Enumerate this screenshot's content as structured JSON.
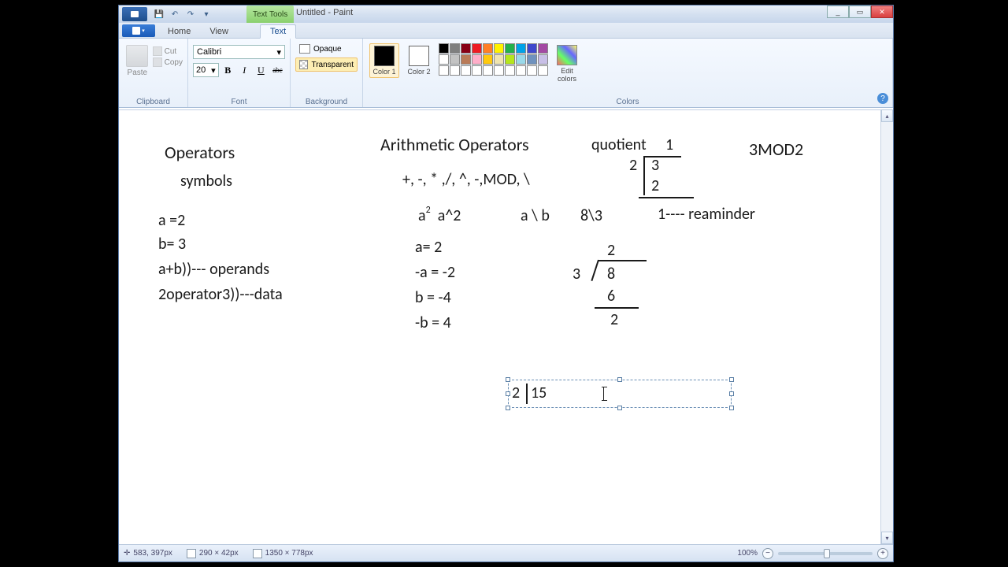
{
  "titlebar": {
    "text_tools": "Text Tools",
    "title": "Untitled - Paint",
    "min": "_",
    "max": "▭",
    "close": "✕"
  },
  "tabs": {
    "home": "Home",
    "view": "View",
    "text": "Text"
  },
  "ribbon": {
    "clipboard": {
      "paste": "Paste",
      "cut": "Cut",
      "copy": "Copy",
      "label": "Clipboard"
    },
    "font": {
      "name": "Calibri",
      "size": "20",
      "b": "B",
      "i": "I",
      "u": "U",
      "s": "abc",
      "label": "Font"
    },
    "background": {
      "opaque": "Opaque",
      "transparent": "Transparent",
      "label": "Background"
    },
    "colors": {
      "color1": "Color 1",
      "color2": "Color 2",
      "edit": "Edit colors",
      "label": "Colors"
    }
  },
  "palette": {
    "row1": [
      "#000000",
      "#7f7f7f",
      "#880015",
      "#ed1c24",
      "#ff7f27",
      "#fff200",
      "#22b14c",
      "#00a2e8",
      "#3f48cc",
      "#a349a4"
    ],
    "row2": [
      "#ffffff",
      "#c3c3c3",
      "#b97a57",
      "#ffaec9",
      "#ffc90e",
      "#efe4b0",
      "#b5e61d",
      "#99d9ea",
      "#7092be",
      "#c8bfe7"
    ]
  },
  "canvas": {
    "c1": "Operators",
    "c2": "symbols",
    "c3": "a =2",
    "c4": "b= 3",
    "c5": "a+b))--- operands",
    "c6": "2operator3))---data",
    "c7": "Arithmetic Operators",
    "c8": "+, -, * ,/, ^, -,MOD, \\",
    "c9a": "a",
    "c9b": "2",
    "c9c": "a^2",
    "c10": "a \\ b",
    "c11": "8\\3",
    "c12": "a= 2",
    "c13": "-a =  -2",
    "c14": "b = -4",
    "c15": "-b = 4",
    "c16": "quotient",
    "c17": "1",
    "c18": "2",
    "c19": "3",
    "c20": "2",
    "c21": "1---- reaminder",
    "c22": "3MOD2",
    "c23": "2",
    "c24": "3",
    "c25": "8",
    "c26": "6",
    "c27": "2",
    "tb1": "2",
    "tb2": "15"
  },
  "status": {
    "pos": "583, 397px",
    "sel": "290 × 42px",
    "size": "1350 × 778px",
    "zoom": "100%"
  }
}
